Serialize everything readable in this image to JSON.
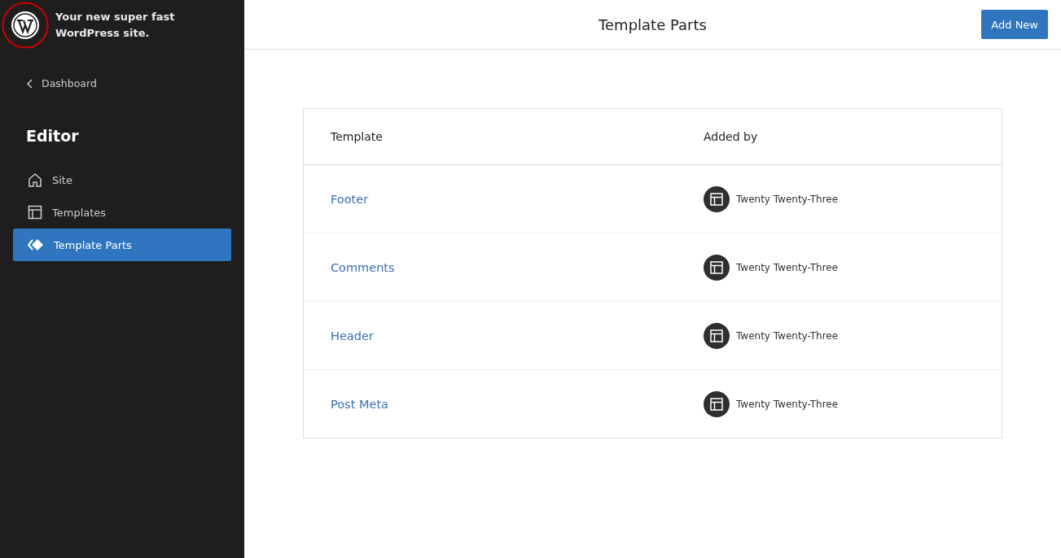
{
  "sidebar": {
    "site_title": "Your new super fast WordPress site.",
    "back_link": "Dashboard",
    "heading": "Editor",
    "items": [
      {
        "label": "Site",
        "kind": "house",
        "selected": false
      },
      {
        "label": "Templates",
        "kind": "layout",
        "selected": false
      },
      {
        "label": "Template Parts",
        "kind": "diamond",
        "selected": true
      }
    ]
  },
  "header": {
    "title": "Template Parts",
    "button": "Add New"
  },
  "table": {
    "columns": [
      "Template",
      "Added by"
    ],
    "rows": [
      {
        "template": "Footer",
        "added_by": "Twenty Twenty-Three"
      },
      {
        "template": "Comments",
        "added_by": "Twenty Twenty-Three"
      },
      {
        "template": "Header",
        "added_by": "Twenty Twenty-Three"
      },
      {
        "template": "Post Meta",
        "added_by": "Twenty Twenty-Three"
      }
    ]
  }
}
